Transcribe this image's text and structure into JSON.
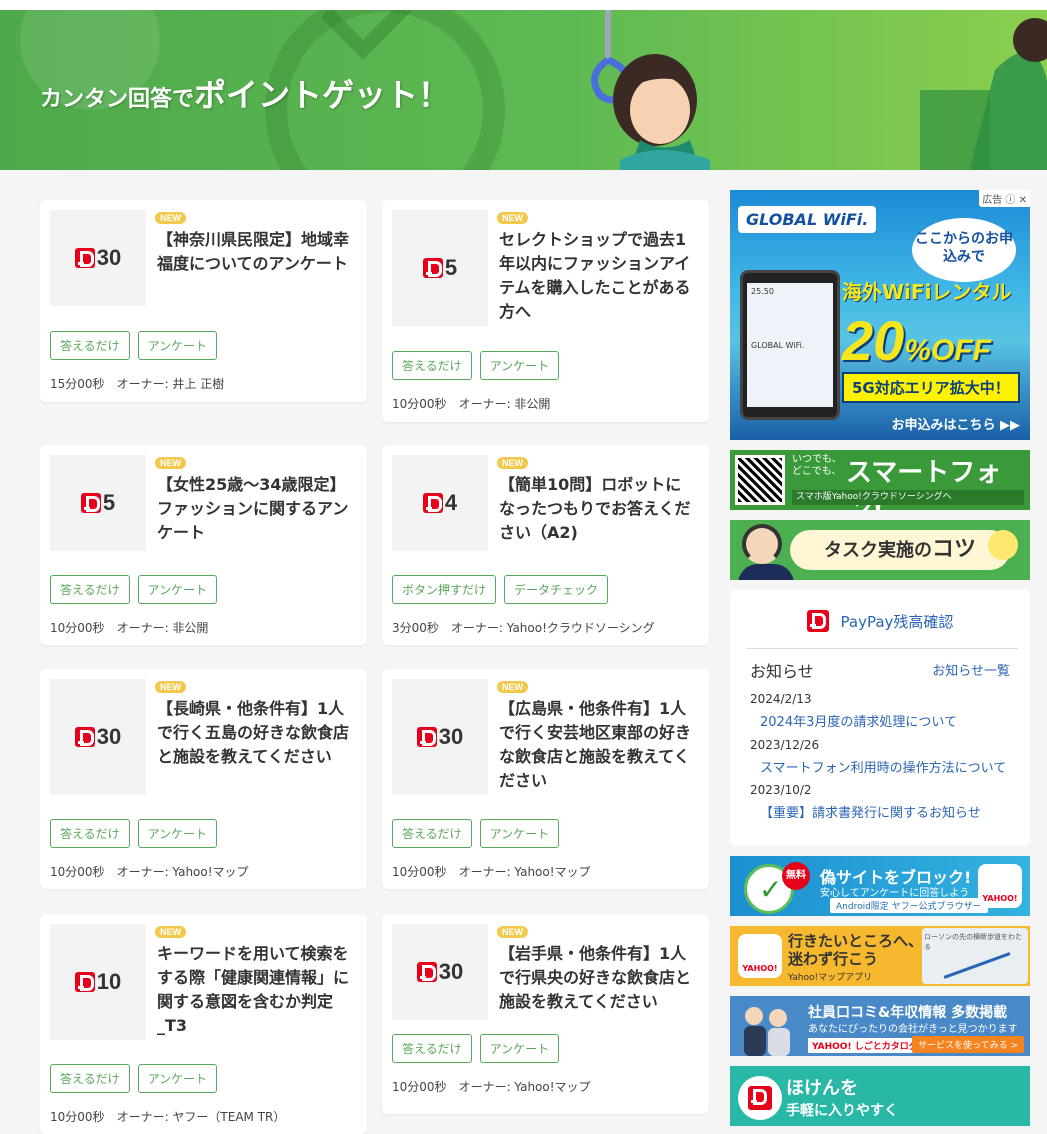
{
  "hero": {
    "title_small": "カンタン回答で",
    "title_big": "ポイントゲット！"
  },
  "tasks": [
    {
      "points": "30",
      "new": "NEW",
      "title": "【神奈川県民限定】地域幸福度についてのアンケート",
      "tags": [
        "答えるだけ",
        "アンケート"
      ],
      "time": "15分00秒",
      "owner": "オーナー: 井上 正樹"
    },
    {
      "points": "5",
      "new": "NEW",
      "title": "セレクトショップで過去1年以内にファッションアイテムを購入したことがある方へ",
      "tags": [
        "答えるだけ",
        "アンケート"
      ],
      "time": "10分00秒",
      "owner": "オーナー: 非公開"
    },
    {
      "points": "5",
      "new": "NEW",
      "title": "【女性25歳～34歳限定】ファッションに関するアンケート",
      "tags": [
        "答えるだけ",
        "アンケート"
      ],
      "time": "10分00秒",
      "owner": "オーナー: 非公開"
    },
    {
      "points": "4",
      "new": "NEW",
      "title": "【簡単10問】ロボットになったつもりでお答えください（A2)",
      "tags": [
        "ボタン押すだけ",
        "データチェック"
      ],
      "time": "3分00秒",
      "owner": "オーナー: Yahoo!クラウドソーシング"
    },
    {
      "points": "30",
      "new": "NEW",
      "title": "【長崎県・他条件有】1人で行く五島の好きな飲食店と施設を教えてください",
      "tags": [
        "答えるだけ",
        "アンケート"
      ],
      "time": "10分00秒",
      "owner": "オーナー: Yahoo!マップ"
    },
    {
      "points": "30",
      "new": "NEW",
      "title": "【広島県・他条件有】1人で行く安芸地区東部の好きな飲食店と施設を教えてください",
      "tags": [
        "答えるだけ",
        "アンケート"
      ],
      "time": "10分00秒",
      "owner": "オーナー: Yahoo!マップ"
    },
    {
      "points": "10",
      "new": "NEW",
      "title": "キーワードを用いて検索をする際「健康関連情報」に関する意図を含むか判定_T3",
      "tags": [
        "答えるだけ",
        "アンケート"
      ],
      "time": "10分00秒",
      "owner": "オーナー: ヤフー（TEAM TR）"
    },
    {
      "points": "30",
      "new": "NEW",
      "title": "【岩手県・他条件有】1人で行県央の好きな飲食店と施設を教えてください",
      "tags": [
        "答えるだけ",
        "アンケート"
      ],
      "time": "10分00秒",
      "owner": "オーナー: Yahoo!マップ"
    }
  ],
  "ad_global": {
    "label": "広告",
    "brand": "GLOBAL WiFi.",
    "bubble": "ここからのお申込みで",
    "rental": "海外WiFiレンタル",
    "discount": "20",
    "discount_unit": "%OFF",
    "band": "5G対応エリア拡大中！",
    "apply": "お申込みはこちら ▶▶",
    "phone_speed": "25.50",
    "phone_brand": "GLOBAL WiFi."
  },
  "banner_smart": {
    "small": "いつでも、どこでも、",
    "big": "スマートフォン!",
    "sub": "スマホ版Yahoo!クラウドソーシングへ"
  },
  "banner_task": {
    "text": "タスク実施の",
    "bold": "コツ"
  },
  "info": {
    "paypay": "PayPay残高確認",
    "news_title": "お知らせ",
    "news_all": "お知らせ一覧",
    "items": [
      {
        "date": "2024/2/13",
        "text": "2024年3月度の請求処理について"
      },
      {
        "date": "2023/12/26",
        "text": "スマートフォン利用時の操作方法について"
      },
      {
        "date": "2023/10/2",
        "text": "【重要】請求書発行に関するお知らせ"
      }
    ]
  },
  "banner_block": {
    "free": "無料",
    "t1": "偽サイトをブロック!",
    "t2": "安心してアンケートに回答しよう",
    "t3": "Android限定 ヤフー公式ブラウザー",
    "logo": "YAHOO!"
  },
  "banner_map": {
    "logo": "YAHOO!",
    "t1": "行きたいところへ、迷わず行こう",
    "t2": "Yahoo!マップアプリ",
    "note": "ローソンの先の横断歩道をわたる"
  },
  "banner_job": {
    "t1": "社員口コミ&年収情報 多数掲載",
    "t2": "あなたにぴったりの会社がきっと見つかります",
    "t3": "YAHOO! しごとカタログ",
    "btn": "サービスを使ってみる >"
  },
  "banner_hoken": {
    "t1": "ほけんを",
    "t2": "手軽に入りやすく"
  }
}
